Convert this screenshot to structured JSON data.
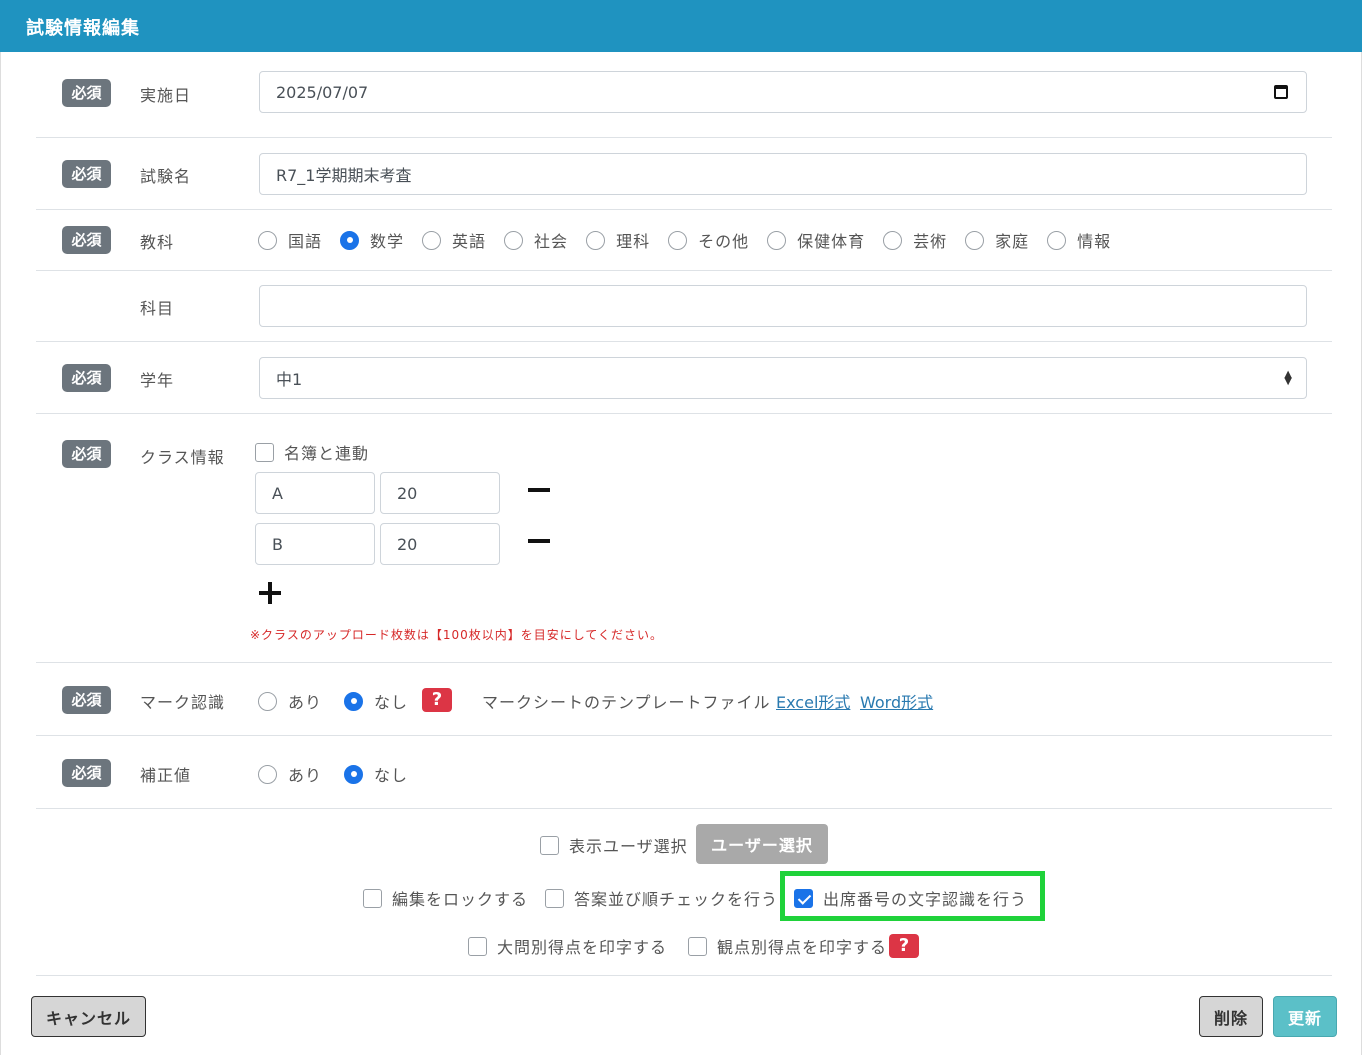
{
  "header": {
    "title": "試験情報編集"
  },
  "required_label": "必須",
  "fields": {
    "date": {
      "label": "実施日",
      "value": "2025/07/07"
    },
    "exam_name": {
      "label": "試験名",
      "value": "R7_1学期期末考査"
    },
    "subject": {
      "label": "教科",
      "options": [
        "国語",
        "数学",
        "英語",
        "社会",
        "理科",
        "その他",
        "保健体育",
        "芸術",
        "家庭",
        "情報"
      ],
      "selected": "数学"
    },
    "course": {
      "label": "科目",
      "value": ""
    },
    "grade": {
      "label": "学年",
      "value": "中1"
    },
    "class_info": {
      "label": "クラス情報",
      "sync_label": "名簿と連動",
      "sync_checked": false,
      "classes": [
        {
          "name": "A",
          "count": "20"
        },
        {
          "name": "B",
          "count": "20"
        }
      ],
      "note": "※クラスのアップロード枚数は【100枚以内】を目安にしてください。"
    },
    "mark_recognition": {
      "label": "マーク認識",
      "options": [
        "あり",
        "なし"
      ],
      "selected": "なし",
      "help": "?",
      "template_label": "マークシートのテンプレートファイル",
      "excel_link": "Excel形式",
      "word_link": "Word形式"
    },
    "correction": {
      "label": "補正値",
      "options": [
        "あり",
        "なし"
      ],
      "selected": "なし"
    }
  },
  "options": {
    "display_user_label": "表示ユーザ選択",
    "user_select_button": "ユーザー選択",
    "lock_edit_label": "編集をロックする",
    "answer_order_label": "答案並び順チェックを行う",
    "attendance_ocr_label": "出席番号の文字認識を行う",
    "attendance_ocr_checked": true,
    "print_major_label": "大問別得点を印字する",
    "print_viewpoint_label": "観点別得点を印字する",
    "help": "?"
  },
  "footer": {
    "cancel_label": "キャンセル",
    "delete_label": "削除",
    "update_label": "更新"
  },
  "colors": {
    "header": "#1f93c0",
    "accent": "#1a73e8",
    "required_badge": "#6c757d",
    "help": "#dc3545",
    "highlight": "#1fd23a",
    "update": "#5bc0c8"
  }
}
